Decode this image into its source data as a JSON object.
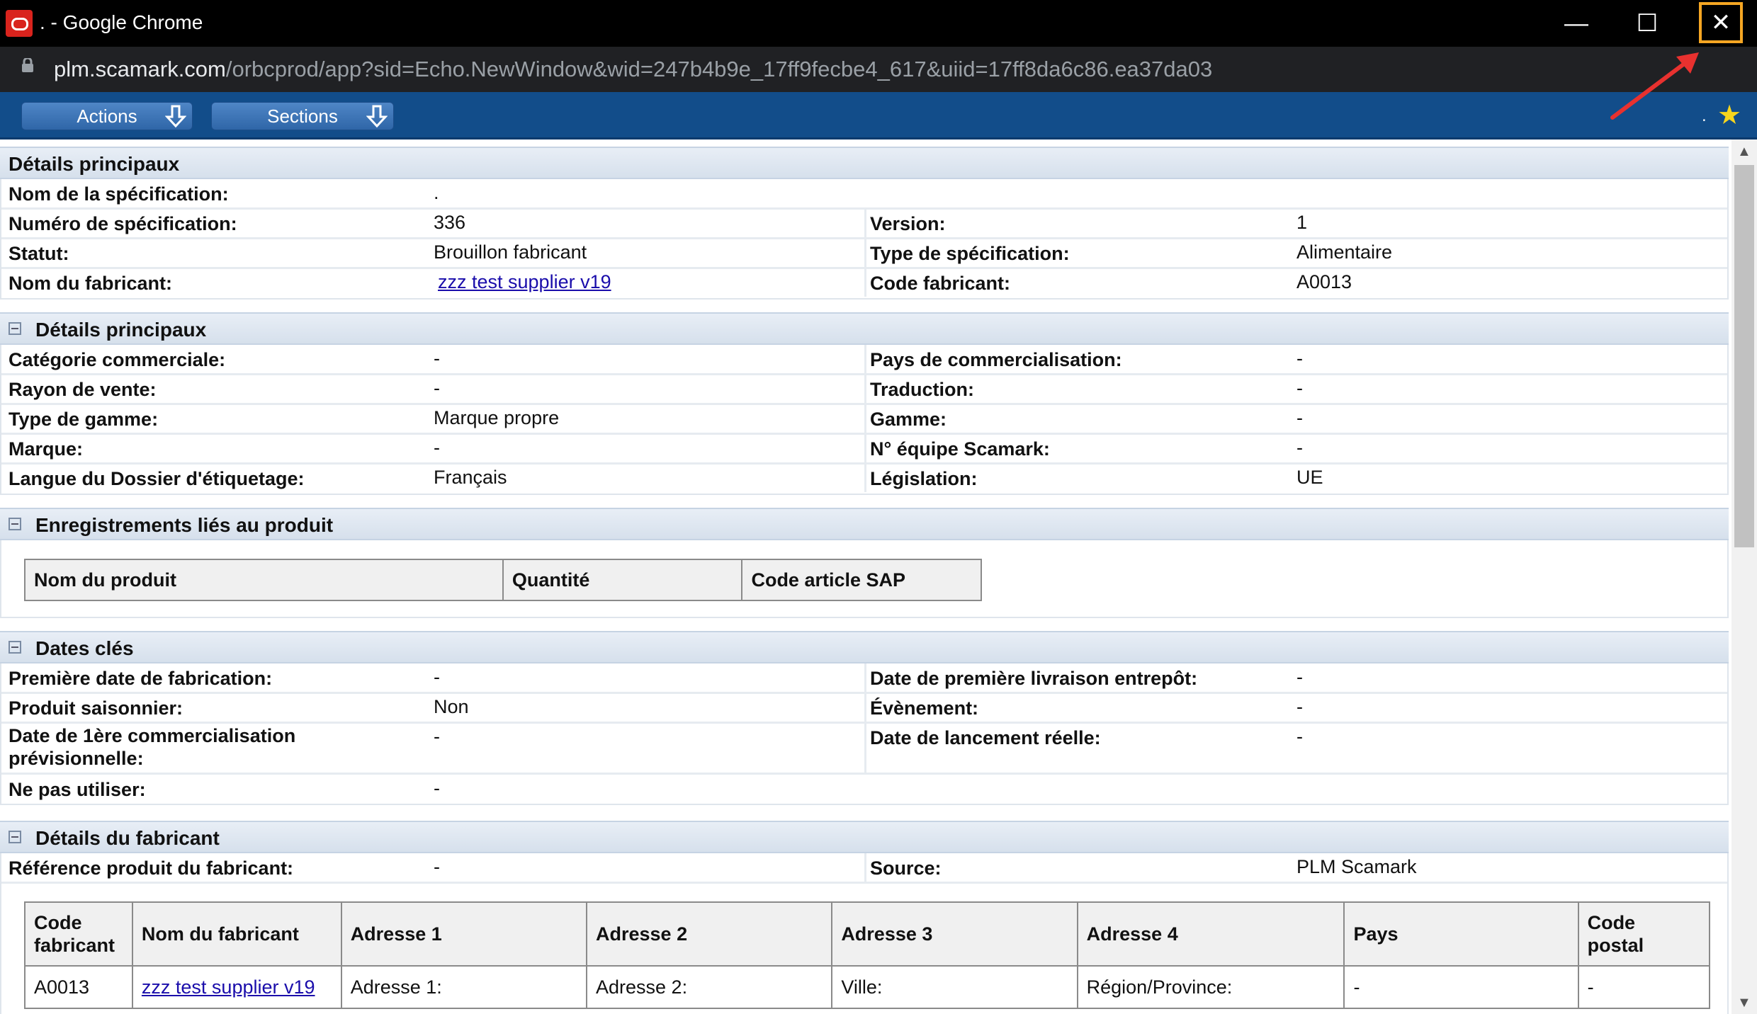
{
  "window": {
    "title": ". - Google Chrome",
    "url_host": "plm.scamark.com",
    "url_path": "/orbcprod/app?sid=Echo.NewWindow&wid=247b4b9e_17ff9fecbe4_617&uiid=17ff8da6c86.ea37da03",
    "minimize_glyph": "—",
    "maximize_glyph": "☐",
    "close_glyph": "✕"
  },
  "toolbar": {
    "actions_label": "Actions",
    "sections_label": "Sections",
    "dot": "."
  },
  "section_main": {
    "title": "Détails principaux",
    "rows": [
      {
        "label": "Nom de la spécification:",
        "value": "."
      },
      {
        "label": "Numéro de spécification:",
        "value": "336",
        "label2": "Version:",
        "value2": "1"
      },
      {
        "label": "Statut:",
        "value": "Brouillon fabricant",
        "label2": "Type de spécification:",
        "value2": "Alimentaire"
      },
      {
        "label": "Nom du fabricant:",
        "value": "zzz test supplier v19",
        "label2": "Code fabricant:",
        "value2": "A0013"
      }
    ]
  },
  "section_details": {
    "title": "Détails principaux",
    "rows": [
      {
        "label": "Catégorie commerciale:",
        "value": "-",
        "label2": "Pays de commercialisation:",
        "value2": "-"
      },
      {
        "label": "Rayon de vente:",
        "value": "-",
        "label2": "Traduction:",
        "value2": "-"
      },
      {
        "label": "Type de gamme:",
        "value": "Marque propre",
        "label2": "Gamme:",
        "value2": "-"
      },
      {
        "label": "Marque:",
        "value": "-",
        "label2": "N° équipe Scamark:",
        "value2": "-"
      },
      {
        "label": "Langue du Dossier d'étiquetage:",
        "value": "Français",
        "label2": "Législation:",
        "value2": "UE"
      }
    ]
  },
  "section_records": {
    "title": "Enregistrements liés au produit",
    "columns": [
      "Nom du produit",
      "Quantité",
      "Code article SAP"
    ]
  },
  "section_dates": {
    "title": "Dates clés",
    "rows": [
      {
        "label": "Première date de fabrication:",
        "value": "-",
        "label2": "Date de première livraison entrepôt:",
        "value2": "-"
      },
      {
        "label": "Produit saisonnier:",
        "value": "Non",
        "label2": "Évènement:",
        "value2": "-"
      },
      {
        "label_line1": "Date de 1ère commercialisation",
        "label_line2": "prévisionnelle:",
        "value": "-",
        "label2": "Date de lancement réelle:",
        "value2": "-"
      },
      {
        "label": "Ne pas utiliser:",
        "value": "-"
      }
    ]
  },
  "section_manufacturer": {
    "title": "Détails du fabricant",
    "row": {
      "label": "Référence produit du fabricant:",
      "value": "-",
      "label2": "Source:",
      "value2": "PLM Scamark"
    },
    "columns": [
      {
        "line1": "Code",
        "line2": "fabricant"
      },
      {
        "line1": "Nom du fabricant"
      },
      {
        "line1": "Adresse 1"
      },
      {
        "line1": "Adresse 2"
      },
      {
        "line1": "Adresse 3"
      },
      {
        "line1": "Adresse 4"
      },
      {
        "line1": "Pays"
      },
      {
        "line1": "Code",
        "line2": "postal"
      }
    ],
    "data_row": [
      "A0013",
      "zzz test supplier v19",
      "Adresse 1:",
      "Adresse 2:",
      "Ville:",
      "Région/Province:",
      "-",
      "-"
    ]
  }
}
